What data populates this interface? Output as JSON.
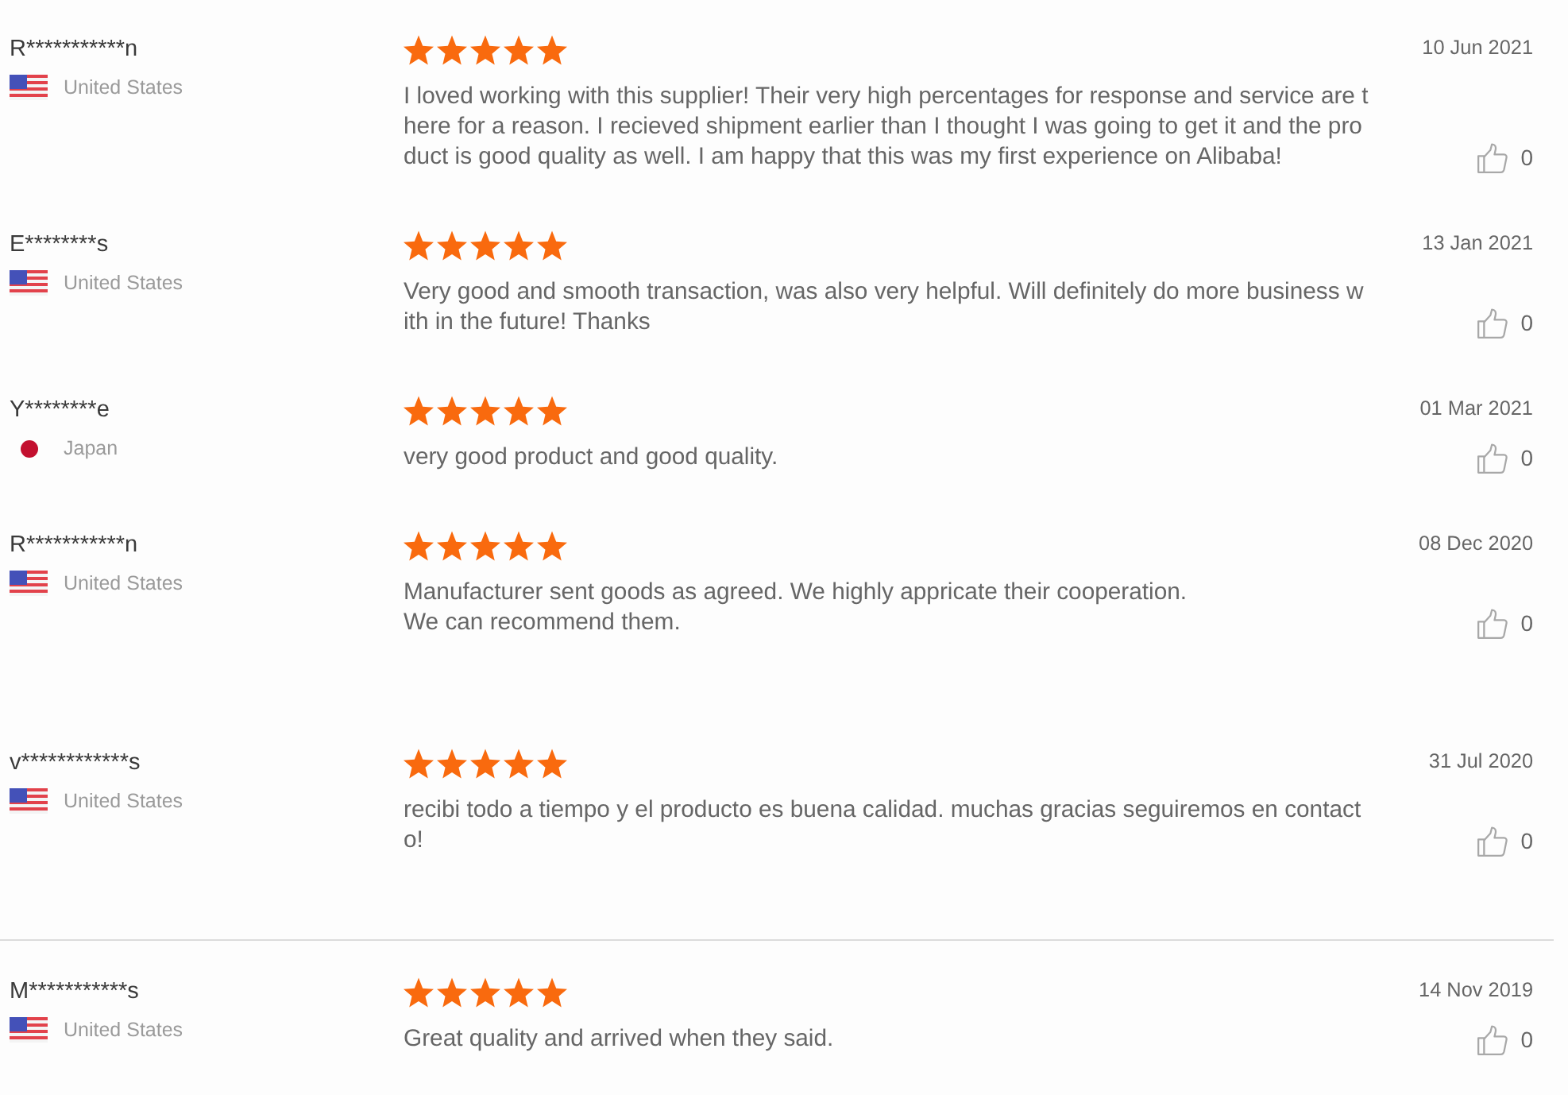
{
  "reviews": [
    {
      "name": "R***********n",
      "kind": "us",
      "country": "United States",
      "stars": 5,
      "date": "10 Jun 2021",
      "lines": [
        "I loved working with this supplier! Their very high percentages for response and service are t",
        "here for a reason. I recieved shipment earlier than I thought I was going to get it and the pro",
        "duct is good quality as well. I am happy that this was my first experience on Alibaba!"
      ],
      "likes": "0",
      "divider_above": false
    },
    {
      "name": "E********s",
      "kind": "us",
      "country": "United States",
      "stars": 5,
      "date": "13 Jan 2021",
      "lines": [
        "Very good and smooth transaction, was also very helpful. Will definitely do more business w",
        "ith in the future! Thanks"
      ],
      "likes": "0",
      "divider_above": false
    },
    {
      "name": "Y********e",
      "kind": "japan",
      "country": "Japan",
      "stars": 5,
      "date": "01 Mar 2021",
      "lines": [
        "very good product and good quality."
      ],
      "likes": "0",
      "divider_above": false
    },
    {
      "name": "R***********n",
      "kind": "us",
      "country": "United States",
      "stars": 5,
      "date": "08 Dec 2020",
      "lines": [
        "Manufacturer sent goods as agreed. We highly appricate their cooperation.",
        "We can recommend them."
      ],
      "likes": "0",
      "divider_above": false
    },
    {
      "name": "v************s",
      "kind": "us",
      "country": "United States",
      "stars": 5,
      "date": "31 Jul 2020",
      "lines": [
        "recibi todo a tiempo y el producto es buena calidad. muchas gracias seguiremos en contact",
        "o!"
      ],
      "likes": "0",
      "divider_above": false
    },
    {
      "name": "M***********s",
      "kind": "us",
      "country": "United States",
      "stars": 5,
      "date": "14 Nov 2019",
      "lines": [
        "Great quality and arrived when they said."
      ],
      "likes": "0",
      "divider_above": true
    }
  ]
}
